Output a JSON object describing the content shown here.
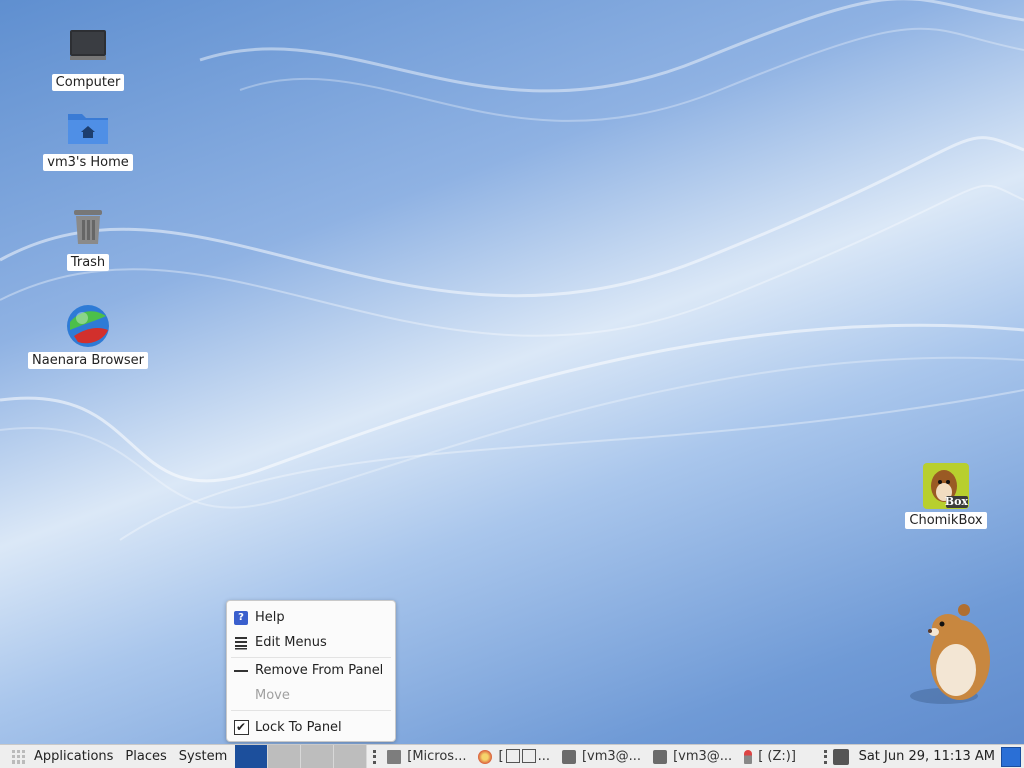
{
  "desktop": {
    "icons": [
      {
        "label": "Computer",
        "icon": "computer-icon"
      },
      {
        "label": "vm3's Home",
        "icon": "home-folder-icon"
      },
      {
        "label": "Trash",
        "icon": "trash-icon"
      },
      {
        "label": "Naenara Browser",
        "icon": "globe-browser-icon"
      },
      {
        "label": "ChomikBox",
        "icon": "chomikbox-icon",
        "badge": "Box"
      }
    ]
  },
  "context_menu": {
    "items": [
      {
        "label": "Help",
        "icon": "help-icon"
      },
      {
        "label": "Edit Menus",
        "icon": "list-icon"
      },
      {
        "label": "Remove From Panel",
        "icon": "remove-icon"
      },
      {
        "label": "Move",
        "icon": "",
        "disabled": true
      },
      {
        "label": "Lock To Panel",
        "icon": "checkbox-checked-icon",
        "checked": true
      }
    ]
  },
  "panel": {
    "menus": [
      "Applications",
      "Places",
      "System"
    ],
    "workspaces": [
      {
        "active": true
      },
      {
        "active": false
      },
      {
        "active": false
      },
      {
        "active": false
      }
    ],
    "tasks": [
      {
        "label": "[Micros...",
        "icon": "folder-icon"
      },
      {
        "label": "[",
        "icon": "browser-icon"
      },
      {
        "label": "[vm3@...",
        "icon": "terminal-icon"
      },
      {
        "label": "[vm3@...",
        "icon": "mail-icon"
      },
      {
        "label": "[ (Z:)]",
        "icon": "pin-icon"
      }
    ],
    "clock": "Sat Jun 29, 11:13 AM"
  },
  "colors": {
    "panel_bg": "#eeeeee",
    "active_workspace": "#1c4f9c",
    "inactive_workspace": "#bdbdbd"
  }
}
